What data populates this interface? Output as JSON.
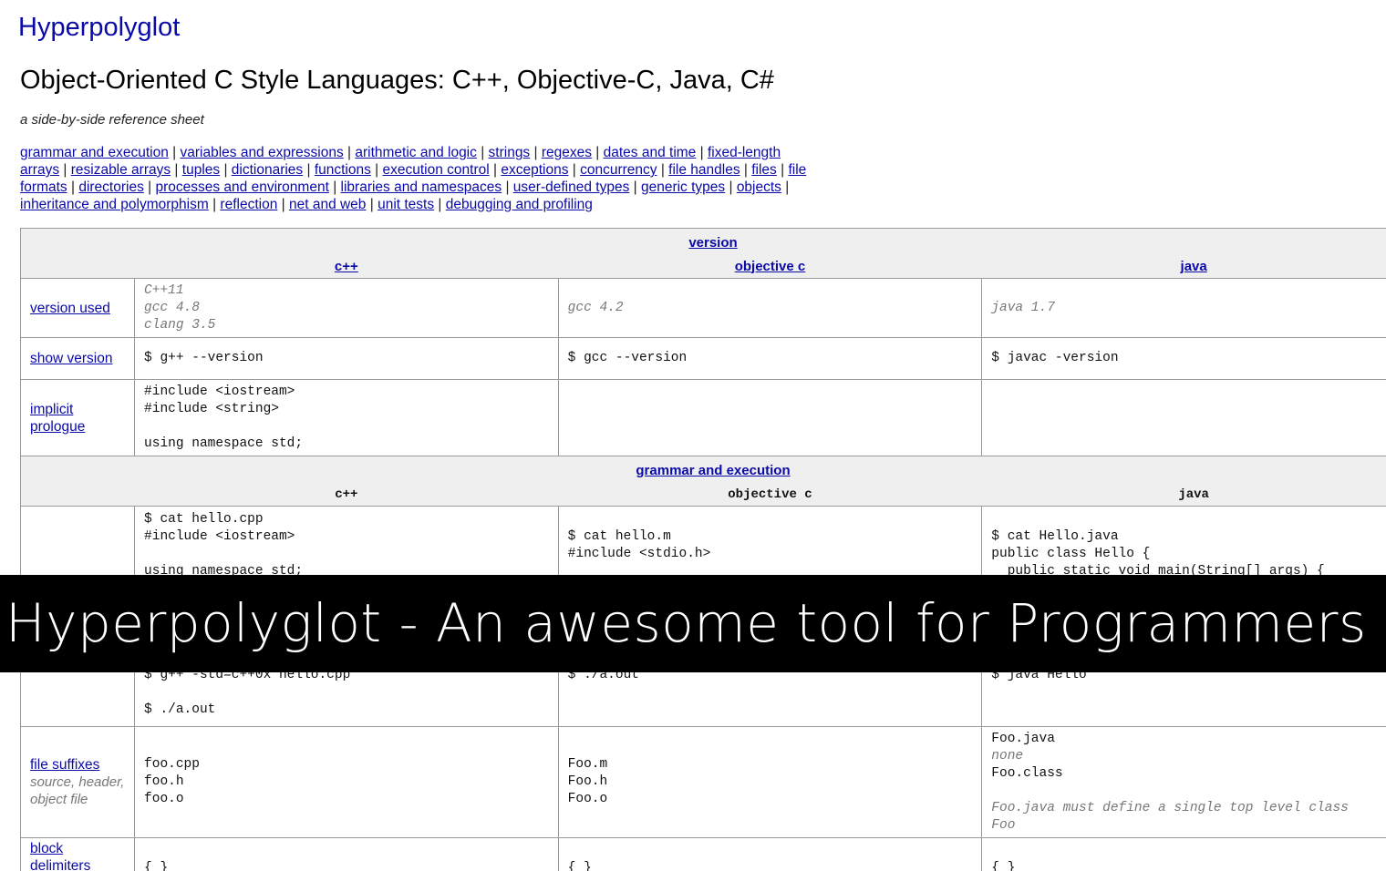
{
  "site": {
    "title": "Hyperpolyglot"
  },
  "page": {
    "title": "Object-Oriented C Style Languages: C++, Objective-C, Java, C#",
    "subtitle": "a side-by-side reference sheet"
  },
  "toc": [
    "grammar and execution",
    "variables and expressions",
    "arithmetic and logic",
    "strings",
    "regexes",
    "dates and time",
    "fixed-length arrays",
    "resizable arrays",
    "tuples",
    "dictionaries",
    "functions",
    "execution control",
    "exceptions",
    "concurrency",
    "file handles",
    "files",
    "file formats",
    "directories",
    "processes and environment",
    "libraries and namespaces",
    "user-defined types",
    "generic types",
    "objects",
    "inheritance and polymorphism",
    "reflection",
    "net and web",
    "unit tests",
    "debugging and profiling"
  ],
  "table": {
    "sections": {
      "version": "version",
      "grammar": "grammar and execution"
    },
    "languages": [
      "c++",
      "objective c",
      "java"
    ],
    "rows": {
      "version_used": {
        "label": "version used",
        "cpp": "C++11\ngcc 4.8\nclang 3.5",
        "objc": "gcc 4.2",
        "java": "java 1.7"
      },
      "show_version": {
        "label": "show version",
        "cpp": "$ g++ --version",
        "objc": "$ gcc --version",
        "java": "$ javac -version"
      },
      "implicit_prologue": {
        "label": "implicit prologue",
        "cpp": "#include <iostream>\n#include <string>\n\nusing namespace std;",
        "objc": "",
        "java": ""
      },
      "hello_world": {
        "cpp_top": "$ cat hello.cpp\n#include <iostream>\n\nusing namespace std;",
        "cpp_bottom": "$ g++ -std=c++0x hello.cpp\n\n$ ./a.out",
        "objc_top": "\n$ cat hello.m\n#include <stdio.h>",
        "objc_bottom": "\n$ ./a.out",
        "java_top": "\n$ cat Hello.java\npublic class Hello {\n  public static void main(String[] args) {",
        "java_bottom": "\n$ java Hello"
      },
      "file_suffixes": {
        "label": "file suffixes",
        "note": "source, header, object file",
        "cpp": "foo.cpp\nfoo.h\nfoo.o",
        "objc": "Foo.m\nFoo.h\nFoo.o",
        "java_line1": "Foo.java",
        "java_none": "none",
        "java_line3": "Foo.class",
        "java_note": "Foo.java must define a single top level class\nFoo"
      },
      "block_delimiters": {
        "label": "block delimiters",
        "cpp": "{ }",
        "objc": "{ }",
        "java": "{ }"
      }
    }
  },
  "banner": {
    "text": "Hyperpolyglot - An awesome tool for Programmers"
  }
}
